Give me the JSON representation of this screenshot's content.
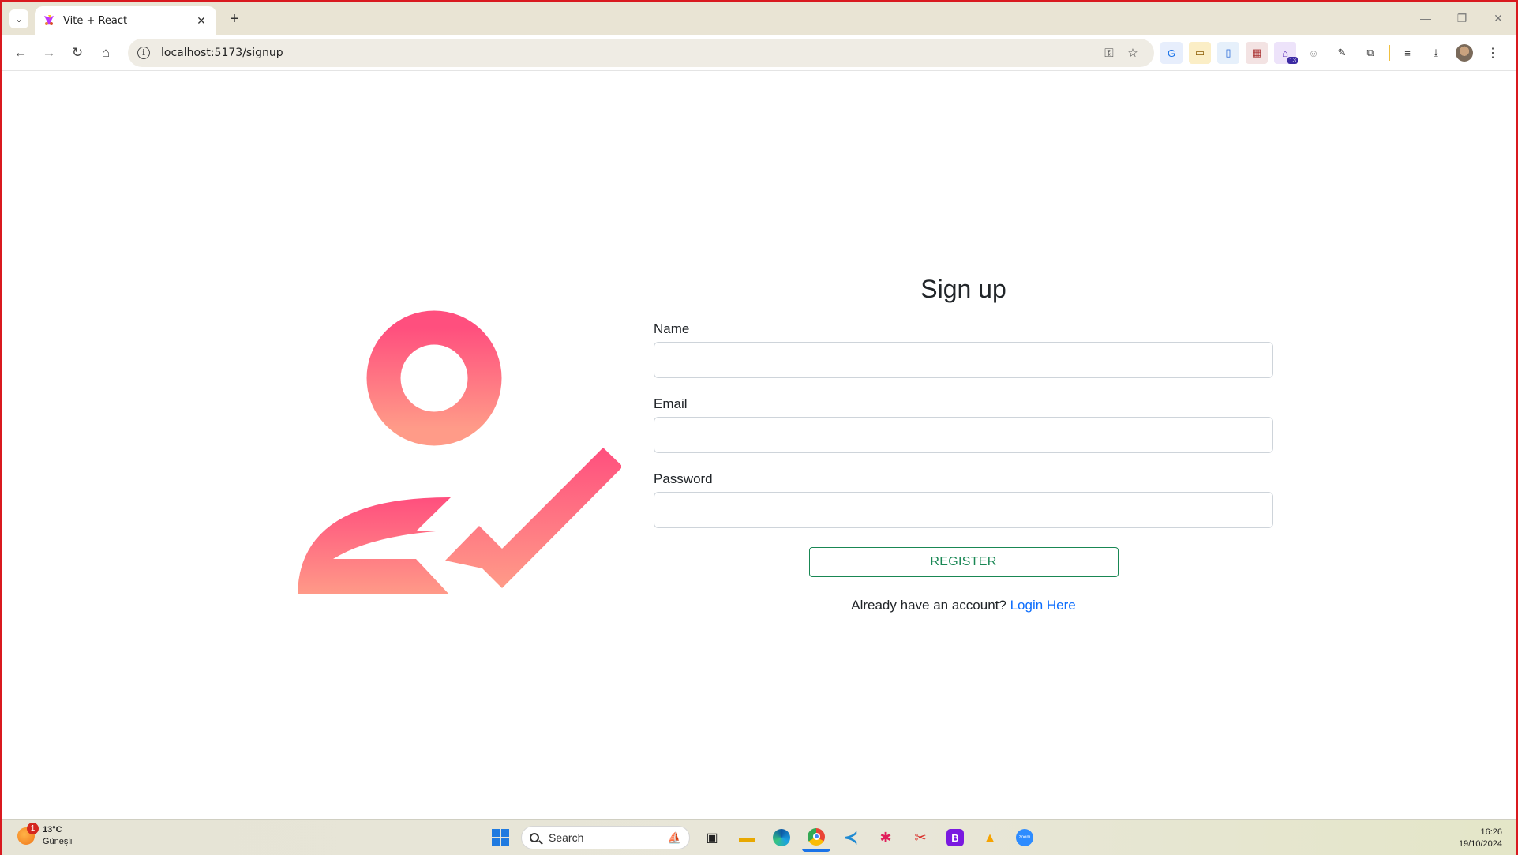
{
  "browser": {
    "tab_title": "Vite + React",
    "tab_close": "✕",
    "new_tab": "+",
    "tab_list": "⌄",
    "url": "localhost:5173/signup",
    "window_controls": {
      "minimize": "—",
      "restore": "❐",
      "close": "✕"
    }
  },
  "toolbar": {
    "back": "←",
    "forward": "→",
    "reload": "↻",
    "home": "⌂",
    "key_icon": "⚿",
    "star_icon": "☆",
    "extensions_badge": "13"
  },
  "form": {
    "title": "Sign up",
    "name_label": "Name",
    "email_label": "Email",
    "password_label": "Password",
    "name_value": "",
    "email_value": "",
    "password_value": "",
    "register_label": "REGISTER",
    "login_prompt": "Already have an account?",
    "login_link": "Login Here"
  },
  "illustration": {
    "icon": "user-check-icon",
    "color_top": "#ff527f",
    "color_bottom": "#ff9a8a"
  },
  "taskbar": {
    "weather_temp": "13°C",
    "weather_desc": "Güneşli",
    "weather_badge": "1",
    "search_placeholder": "Search",
    "time": "16:26",
    "date": "19/10/2024"
  },
  "colors": {
    "register_green": "#198754",
    "link_blue": "#0d6efd",
    "frame_red": "#d9191f"
  }
}
